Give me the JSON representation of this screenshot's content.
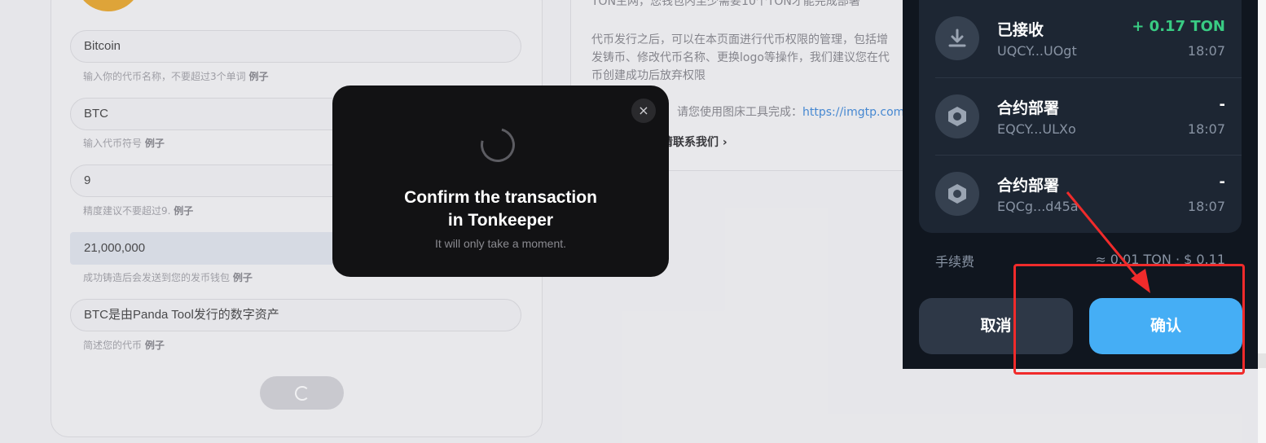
{
  "form": {
    "fields": [
      {
        "value": "Bitcoin",
        "hint": "输入你的代币名称，不要超过3个单词",
        "example": "例子"
      },
      {
        "value": "BTC",
        "hint": "输入代币符号",
        "example": "例子"
      },
      {
        "value": "9",
        "hint": "精度建议不要超过9.",
        "example": "例子"
      },
      {
        "value": "21,000,000",
        "hint": "成功铸造后会发送到您的发币钱包",
        "example": "例子"
      },
      {
        "value": "BTC是由Panda Tool发行的数字资产",
        "hint": "简述您的代币",
        "example": "例子"
      }
    ]
  },
  "info": {
    "line0": "TON主网，您钱包内至少需要10个TON才能完成部署",
    "line1": "代币发行之后，可以在本页面进行代币权限的管理，包括增",
    "line2": "发铸币、修改代币名称、更换logo等操作，我们建议您在代",
    "line3": "币创建成功后放弃权限",
    "logo_hint": "请您使用图床工具完成：",
    "logo_link": "https://imgtp.com",
    "contact": "请联系我们"
  },
  "modal": {
    "close_icon": "×",
    "title_line1": "Confirm the transaction",
    "title_line2": "in Tonkeeper",
    "subtitle": "It will only take a moment."
  },
  "wallet": {
    "transactions": [
      {
        "icon": "download-icon",
        "title": "已接收",
        "address": "UQCY...UOgt",
        "amount": "+ 0.17 TON",
        "time": "18:07"
      },
      {
        "icon": "hexagon-icon",
        "title": "合约部署",
        "address": "EQCY...ULXo",
        "amount": "-",
        "time": "18:07"
      },
      {
        "icon": "hexagon-icon",
        "title": "合约部署",
        "address": "EQCg...d45a",
        "amount": "-",
        "time": "18:07"
      }
    ],
    "fee_label": "手续费",
    "fee_value": "≈ 0.01 TON · $ 0.11",
    "cancel_label": "取消",
    "confirm_label": "确认"
  },
  "colors": {
    "accent": "#45aef5",
    "positive": "#39cc83",
    "annotation": "#f02b2b"
  }
}
